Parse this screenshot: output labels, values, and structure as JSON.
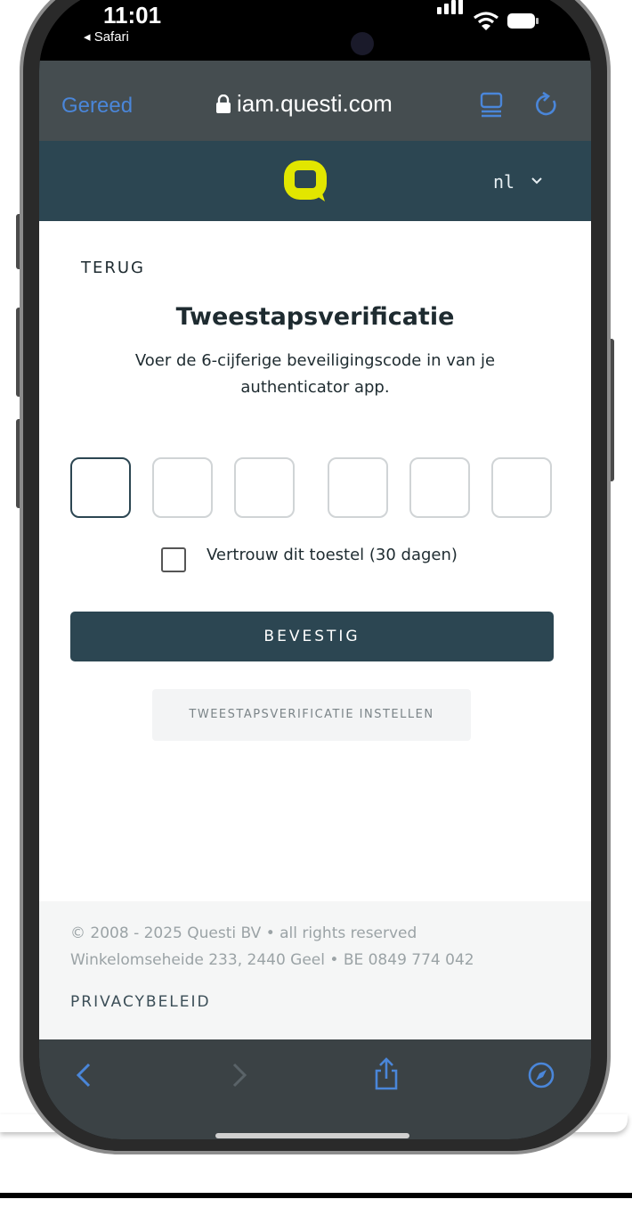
{
  "status_bar": {
    "time": "11:01",
    "back_label": "◂ Safari"
  },
  "browser": {
    "done_label": "Gereed",
    "url": "iam.questi.com",
    "accent_color": "#4a86d9"
  },
  "app_header": {
    "language": "nl",
    "brand_color": "#e2e600",
    "header_color": "#2c4652"
  },
  "page": {
    "back_label": "TERUG",
    "title": "Tweestapsverificatie",
    "subtitle": "Voer de 6-cijferige beveiligingscode in van je authenticator app.",
    "code_inputs": [
      "",
      "",
      "",
      "",
      "",
      ""
    ],
    "trust_label": "Vertrouw dit toestel (30 dagen)",
    "trust_checked": false,
    "confirm_label": "BEVESTIG",
    "setup_label": "TWEESTAPSVERIFICATIE INSTELLEN"
  },
  "footer": {
    "copyright": "© 2008 - 2025 Questi BV • all rights reserved",
    "address": "Winkelomseheide 233, 2440 Geel • BE 0849 774 042",
    "privacy_label": "PRIVACYBELEID"
  },
  "toolbar": {
    "icons": [
      "back-icon",
      "forward-icon",
      "share-icon",
      "compass-icon"
    ]
  }
}
